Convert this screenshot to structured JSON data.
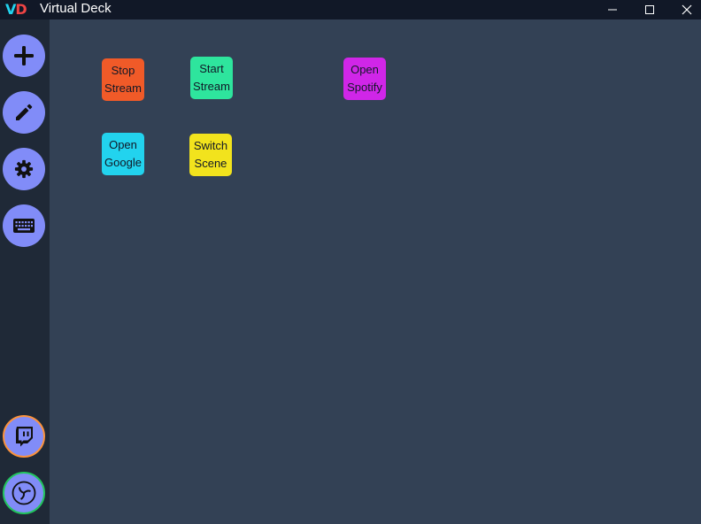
{
  "window": {
    "logo_v": "V",
    "logo_d": "D",
    "title": "Virtual Deck"
  },
  "sidebar": {
    "actions": [
      {
        "icon": "plus-icon"
      },
      {
        "icon": "pencil-icon"
      },
      {
        "icon": "gear-icon"
      },
      {
        "icon": "keyboard-icon"
      }
    ],
    "integrations": [
      {
        "icon": "twitch-icon",
        "ring_color": "#fb923c"
      },
      {
        "icon": "obs-icon",
        "ring_color": "#22c55e"
      }
    ]
  },
  "deck": {
    "buttons": [
      {
        "label": "Stop\nStream",
        "color": "#f05a28"
      },
      {
        "label": "Start\nStream",
        "color": "#2ee59d"
      },
      {
        "label": "Open\nSpotify",
        "color": "#d026e8"
      },
      {
        "label": "Open\nGoogle",
        "color": "#22d3ee"
      },
      {
        "label": "Switch\nScene",
        "color": "#f2e31d"
      }
    ]
  },
  "colors": {
    "background": "#334155",
    "sidebar": "#1f2937",
    "titlebar": "#111827",
    "accent": "#818cf8"
  }
}
